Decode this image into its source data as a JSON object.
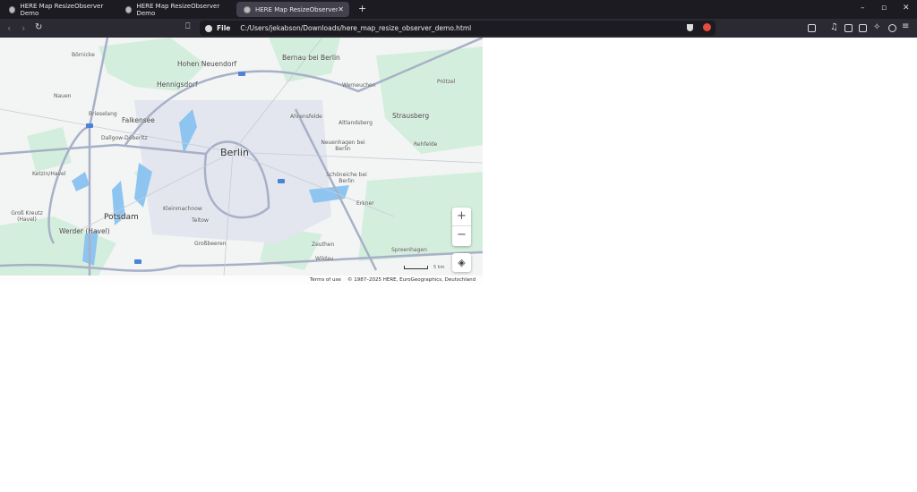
{
  "tabs": [
    {
      "title": "HERE Map ResizeObserver Demo"
    },
    {
      "title": "HERE Map ResizeObserver Demo"
    },
    {
      "title": "HERE Map ResizeObserver Demo",
      "active": true
    }
  ],
  "address": {
    "scheme": "File",
    "url": "C:/Users/jekabson/Downloads/here_map_resize_observer_demo.html"
  },
  "window": {
    "minimize": "–",
    "maximize": "▫",
    "close": "✕"
  },
  "map": {
    "labels": [
      "Börnicke",
      "Hohen Neuendorf",
      "Bernau bei Berlin",
      "Hennigsdorf",
      "Werneuchen",
      "Nauen",
      "Brieselang",
      "Falkensee",
      "Ahrensfelde",
      "Altlandsberg",
      "Strausberg",
      "Dallgow-Döberitz",
      "Neuenhagen bei Berlin",
      "Berlin",
      "Rehfelde",
      "Ketzin/Havel",
      "Schöneiche bei Berlin",
      "Groß Kreutz (Havel)",
      "Potsdam",
      "Kleinmachnow",
      "Teltow",
      "Erkner",
      "Werder (Havel)",
      "Großbeeren",
      "Zeuthen",
      "Spreenhagen",
      "Wildau",
      "Prötzel"
    ],
    "zoom_in": "+",
    "zoom_out": "−",
    "layers_icon": "layers-icon",
    "scale": "5 km",
    "terms": "Terms of use",
    "copyright": "© 1987–2025 HERE, EuroGeographics, Deutschland",
    "colors": {
      "land": "#f3f5f4",
      "forest": "#d4eedd",
      "water": "#8ec5f0",
      "road": "#a8b0c8",
      "urban": "#e3e6ee"
    }
  }
}
